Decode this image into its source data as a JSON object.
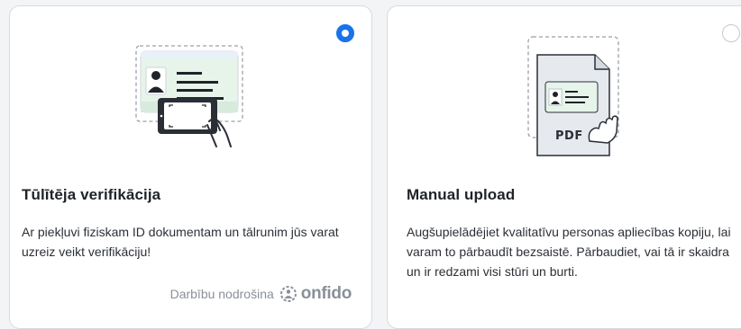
{
  "options": [
    {
      "title": "Tūlītēja verifikācija",
      "description": "Ar piekļuvi fiziskam ID dokumentam un tālrunim jūs varat uzreiz veikt verifikāciju!",
      "powered_by": "Darbību nodrošina",
      "brand": "onfido",
      "selected": true
    },
    {
      "title": "Manual upload",
      "description": "Augšupielādējiet kvalitatīvu personas apliecības kopiju, lai varam to pārbaudīt bezsaistē. Pārbaudiet, vai tā ir skaidra un ir redzami visi stūri un burti.",
      "pdf_label": "PDF",
      "selected": false
    }
  ],
  "colors": {
    "accent": "#1a73e8",
    "border": "#d8dbe0",
    "muted": "#8a9099"
  },
  "icons": [
    "id-card-phone-illustration",
    "pdf-upload-illustration",
    "onfido-logo-icon"
  ]
}
